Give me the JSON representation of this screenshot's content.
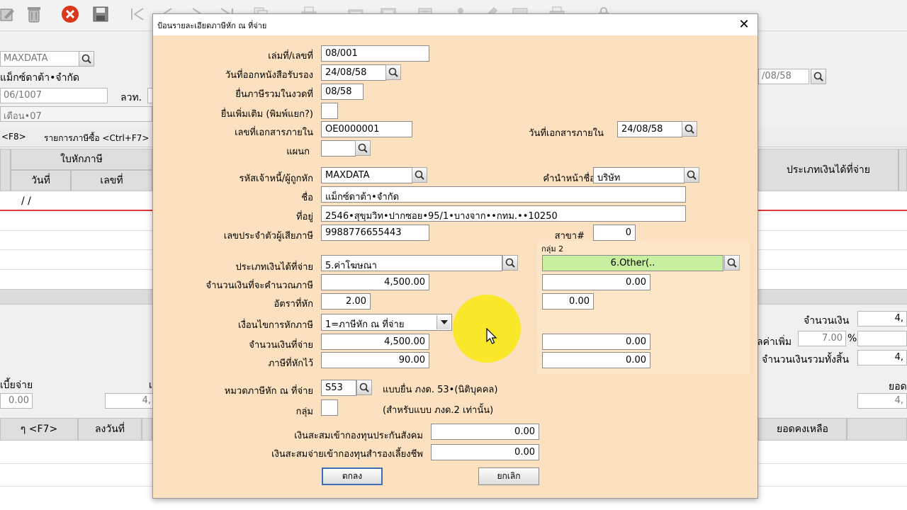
{
  "background": {
    "company_code": "MAXDATA",
    "company_name": "แม็กซ์ดาต้า•จำกัด",
    "doc_no": "06/1007",
    "tax_id_label": "ลวท.",
    "period_text": "เดือน•07",
    "right_date": "/08/58",
    "tab_f8": "<F8>",
    "tab_purchase": "รายการภาษีซื้อ <Ctrl+F7>",
    "grid_group_header": "ใบหักภาษี",
    "grid_col_date": "วันที่",
    "grid_col_number": "เลขที่",
    "grid_col_income_type": "ประเภทเงินได้ที่จ่าย",
    "grid_row1_date": "/ /",
    "amount_label": "จำนวนเงิน",
    "amount_value": "4,",
    "vat_label": "ลค่าเพิ่ม",
    "vat_rate": "7.00",
    "vat_pct": "%",
    "grand_total_label": "จำนวนเงินรวมทั้งสิ้น",
    "grand_total_value": "4,",
    "interest_label": "เบี้ยจ่าย",
    "interest_value": "0.00",
    "mid_value": "4,",
    "total_label": "ยอด",
    "total_value": "4,",
    "bottom_col_f7": "ๆ <F7>",
    "bottom_col_sign_date": "ลงวันที่",
    "bottom_col_balance": "ยอดคงเหลือ"
  },
  "dialog": {
    "title": "ป้อนรายละเอียดภาษีหัก ณ ที่จ่าย",
    "close_glyph": "✕",
    "fields": {
      "book_no_label": "เล่มที่/เลขที่",
      "book_no": "08/001",
      "cert_date_label": "วันที่ออกหนังสือรับรอง",
      "cert_date": "24/08/58",
      "file_period_label": "ยื่นภาษีรวมในงวดที่",
      "file_period": "08/58",
      "additional_label": "ยื่นเพิ่มเติม (พิมพ์แยก?)",
      "internal_doc_label": "เลขที่เอกสารภายใน",
      "internal_doc": "OE0000001",
      "internal_doc_date_label": "วันที่เอกสารภายใน",
      "internal_doc_date": "24/08/58",
      "department_label": "แผนก",
      "department": "",
      "payer_code_label": "รหัสเจ้าหนี้/ผู้ถูกหัก",
      "payer_code": "MAXDATA",
      "prefix_label": "คำนำหน้าชื่อ",
      "prefix": "บริษัท",
      "name_label": "ชื่อ",
      "name": "แม็กซ์ดาต้า•จำกัด",
      "address_label": "ที่อยู่",
      "address": "2546•สุขุมวิท•ปากซอย•95/1•บางจาก••กทม.••10250",
      "tax_id_label": "เลขประจำตัวผู้เสียภาษี",
      "tax_id": "9988776655443",
      "branch_label": "สาขา#",
      "branch": "0",
      "group2_caption": "กลุ่ม 2",
      "income_type_label": "ประเภทเงินได้ที่จ่าย",
      "income_type": "5.ค่าโฆษณา",
      "income_type_2": "6.Other(..",
      "taxable_amount_label": "จำนวนเงินที่จะคำนวณภาษี",
      "taxable_amount": "4,500.00",
      "taxable_amount_2": "0.00",
      "rate_label": "อัตราที่หัก",
      "rate": "2.00",
      "rate_2": "0.00",
      "condition_label": "เงื่อนไขการหักภาษี",
      "condition": "1=ภาษีหัก ณ ที่จ่าย",
      "paid_amount_label": "จำนวนเงินที่จ่าย",
      "paid_amount": "4,500.00",
      "paid_amount_2": "0.00",
      "withheld_label": "ภาษีที่หักไว้",
      "withheld": "90.00",
      "withheld_2": "0.00",
      "wht_category_label": "หมวดภาษีหัก ณ ที่จ่าย",
      "wht_category": "S53",
      "wht_category_desc": "แบบยื่น ภงด. 53•(นิติบุคคล)",
      "group_label": "กลุ่ม",
      "group": "",
      "group_desc": "(สำหรับแบบ ภงด.2 เท่านั้น)",
      "social_security_label": "เงินสะสมเข้ากองทุนประกันสังคม",
      "social_security": "0.00",
      "provident_fund_label": "เงินสะสมจ่ายเข้ากองทุนสำรองเลี้ยงชีพ",
      "provident_fund": "0.00"
    },
    "ok_label": "ตกลง",
    "cancel_label": "ยกเลิก"
  },
  "colors": {
    "dialog_bg": "#fbe1bf",
    "highlight_green": "#c6ef9f",
    "cursor_highlight": "#f8e81c"
  }
}
